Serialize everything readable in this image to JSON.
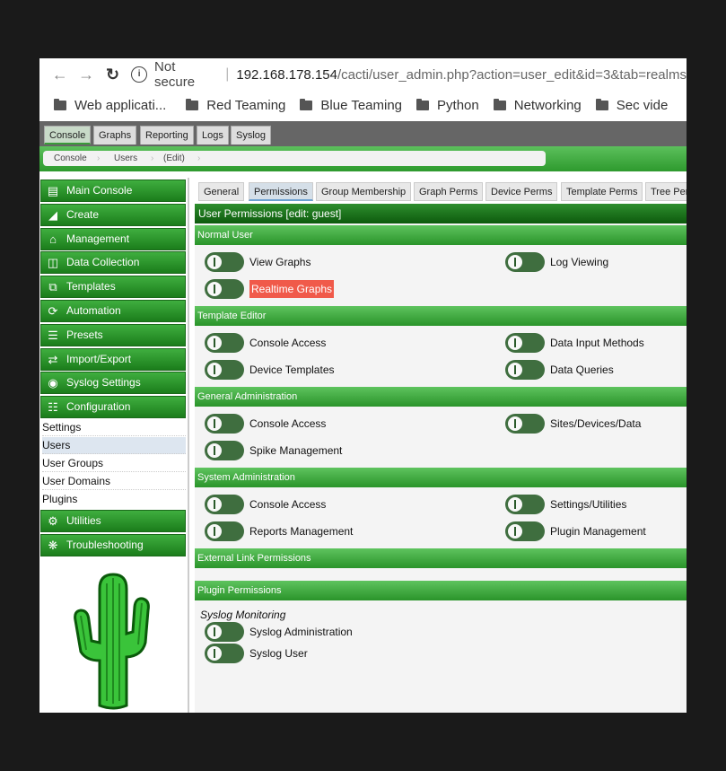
{
  "browser": {
    "not_secure": "Not secure",
    "url_host": "192.168.178.154",
    "url_path": "/cacti/user_admin.php?action=user_edit&id=3&tab=realms",
    "bookmarks": [
      "Web applicati...",
      "Red Teaming",
      "Blue Teaming",
      "Python",
      "Networking",
      "Sec vide"
    ]
  },
  "top_tabs": [
    "Console",
    "Graphs",
    "Reporting",
    "Logs",
    "Syslog"
  ],
  "breadcrumbs": [
    "Console",
    "Users",
    "(Edit)"
  ],
  "sidebar": {
    "menus": [
      {
        "label": "Main Console",
        "icon": "book-icon"
      },
      {
        "label": "Create",
        "icon": "chart-area-icon"
      },
      {
        "label": "Management",
        "icon": "home-icon"
      },
      {
        "label": "Data Collection",
        "icon": "database-icon"
      },
      {
        "label": "Templates",
        "icon": "clone-icon"
      },
      {
        "label": "Automation",
        "icon": "spinner-icon"
      },
      {
        "label": "Presets",
        "icon": "list-icon"
      },
      {
        "label": "Import/Export",
        "icon": "exchange-icon"
      },
      {
        "label": "Syslog Settings",
        "icon": "life-ring-icon"
      },
      {
        "label": "Configuration",
        "icon": "sliders-icon"
      }
    ],
    "config_items": [
      "Settings",
      "Users",
      "User Groups",
      "User Domains",
      "Plugins"
    ],
    "bottom_menus": [
      {
        "label": "Utilities",
        "icon": "cogs-icon"
      },
      {
        "label": "Troubleshooting",
        "icon": "bug-icon"
      }
    ]
  },
  "page_tabs": [
    "General",
    "Permissions",
    "Group Membership",
    "Graph Perms",
    "Device Perms",
    "Template Perms",
    "Tree Per"
  ],
  "header": "User Permissions [edit: guest]",
  "sections": {
    "normal_user": {
      "title": "Normal User",
      "items": [
        "View Graphs",
        "Log Viewing",
        "Realtime Graphs"
      ]
    },
    "template_editor": {
      "title": "Template Editor",
      "items": [
        "Console Access",
        "Data Input Methods",
        "Device Templates",
        "Data Queries"
      ]
    },
    "general_admin": {
      "title": "General Administration",
      "items": [
        "Console Access",
        "Sites/Devices/Data",
        "Spike Management"
      ]
    },
    "system_admin": {
      "title": "System Administration",
      "items": [
        "Console Access",
        "Settings/Utilities",
        "Reports Management",
        "Plugin Management"
      ]
    },
    "external": {
      "title": "External Link Permissions"
    },
    "plugin": {
      "title": "Plugin Permissions",
      "group": "Syslog Monitoring",
      "items": [
        "Syslog Administration",
        "Syslog User"
      ]
    }
  }
}
